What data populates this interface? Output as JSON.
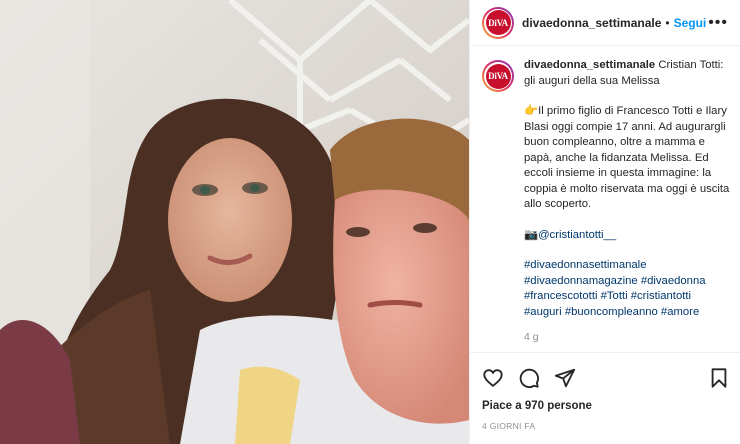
{
  "post": {
    "username": "divaedonna_settimanale",
    "dot": "•",
    "follow_label": "Segui",
    "more_label": "•••",
    "avatar_text": "DiVA"
  },
  "caption": {
    "username": "divaedonna_settimanale",
    "title": " Cristian Totti: gli auguri della sua Melissa",
    "emoji1": "👉",
    "body": "Il primo figlio di Francesco Totti e Ilary Blasi oggi compie 17 anni. Ad augurargli buon compleanno, oltre a mamma e papà, anche la fidanzata Melissa. Ed eccoli insieme in questa immagine: la coppia è molto riservata ma oggi è uscita allo scoperto.",
    "emoji2": "📷",
    "mention": "@cristiantotti__",
    "hashtags_line1": "#divaedonnasettimanale",
    "hashtags_line2": "#divaedonnamagazine #divaedonna",
    "hashtags_line3": "#francescototti #Totti #cristiantotti",
    "hashtags_line4": "#auguri #buoncompleanno #amore",
    "time_ago": "4 g"
  },
  "actions": {
    "icons": [
      "heart-icon",
      "comment-icon",
      "share-icon",
      "bookmark-icon"
    ],
    "likes": "Piace a 970 persone",
    "date": "4 GIORNI FA"
  },
  "colors": {
    "link": "#00376b",
    "follow": "#0095f6",
    "muted": "#8e8e8e",
    "brand": "#c8102e"
  }
}
